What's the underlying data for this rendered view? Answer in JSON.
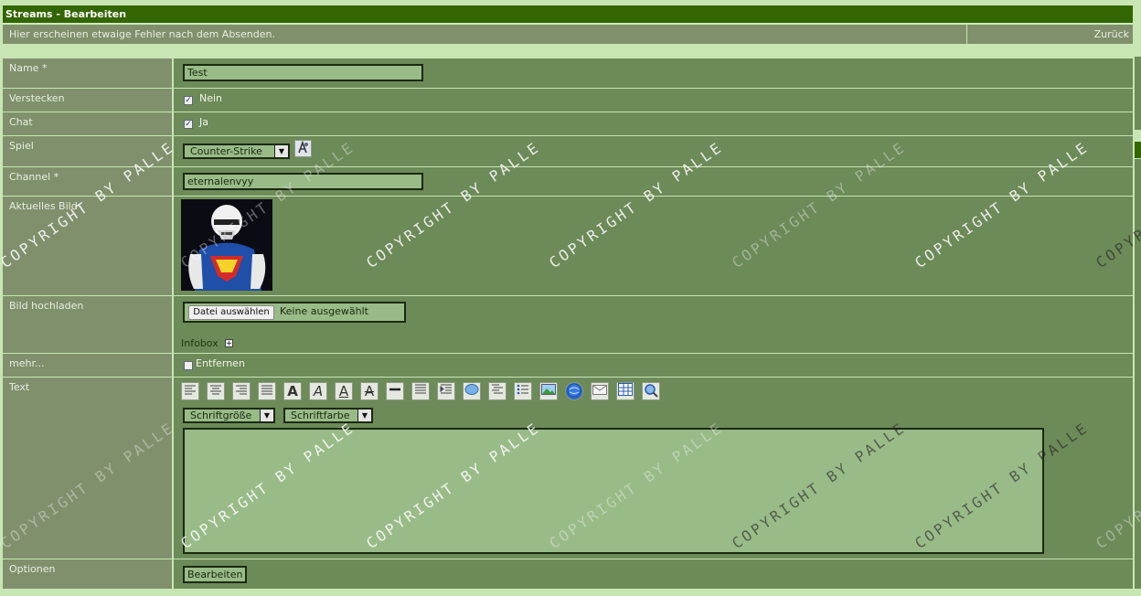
{
  "window": {
    "title": "Streams - Bearbeiten"
  },
  "info": {
    "message": "Hier erscheinen etwaige Fehler nach dem Absenden.",
    "back_label": "Zurück"
  },
  "form": {
    "name": {
      "label": "Name *",
      "value": "Test"
    },
    "hide": {
      "label": "Verstecken",
      "checkbox_label": "Nein",
      "checked": true
    },
    "chat": {
      "label": "Chat",
      "checkbox_label": "Ja",
      "checked": true
    },
    "game": {
      "label": "Spiel",
      "selected": "Counter-Strike"
    },
    "channel": {
      "label": "Channel *",
      "value": "eternalenvyy"
    },
    "current_image": {
      "label": "Aktuelles Bild"
    },
    "upload": {
      "label": "Bild hochladen",
      "button_label": "Datei auswählen",
      "status": "Keine ausgewählt",
      "infobox_label": "Infobox"
    },
    "more": {
      "label": "mehr...",
      "checkbox_label": "Entfernen",
      "checked": false
    },
    "text": {
      "label": "Text",
      "font_size_label": "Schriftgröße",
      "font_color_label": "Schriftfarbe",
      "value": ""
    },
    "options": {
      "label": "Optionen",
      "submit_label": "Bearbeiten"
    }
  },
  "toolbar_icons": [
    "align-left-icon",
    "align-center-icon",
    "align-right-icon",
    "align-justify-icon",
    "bold-icon",
    "italic-icon",
    "underline-icon",
    "strikethrough-icon",
    "horizontal-rule-icon",
    "list-icon",
    "indent-icon",
    "quote-icon",
    "code-icon",
    "bullet-list-icon",
    "image-icon",
    "link-icon",
    "email-icon",
    "table-icon",
    "search-icon"
  ],
  "watermark": "COPYRIGHT BY PALLE",
  "colors": {
    "title_bar": "#336600",
    "label_bg": "#80906c",
    "value_bg": "#6d8a59",
    "input_bg": "#99bb88",
    "page_bg": "#c8e6b4"
  }
}
